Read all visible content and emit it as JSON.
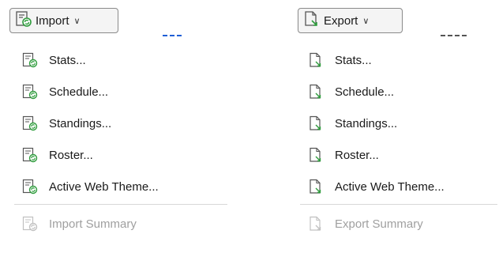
{
  "import_menu": {
    "button_label": "Import",
    "button_icon": "import-icon",
    "chevron_icon": "chevron-down-icon",
    "items": [
      {
        "label": "Stats...",
        "icon": "import-icon"
      },
      {
        "label": "Schedule...",
        "icon": "import-icon"
      },
      {
        "label": "Standings...",
        "icon": "import-icon"
      },
      {
        "label": "Roster...",
        "icon": "import-icon"
      },
      {
        "label": "Active Web Theme...",
        "icon": "import-icon"
      }
    ],
    "summary": {
      "label": "Import Summary",
      "icon": "import-icon",
      "disabled": true
    }
  },
  "export_menu": {
    "button_label": "Export",
    "button_icon": "export-icon",
    "chevron_icon": "chevron-down-icon",
    "items": [
      {
        "label": "Stats...",
        "icon": "export-icon"
      },
      {
        "label": "Schedule...",
        "icon": "export-icon"
      },
      {
        "label": "Standings...",
        "icon": "export-icon"
      },
      {
        "label": "Roster...",
        "icon": "export-icon"
      },
      {
        "label": "Active Web Theme...",
        "icon": "export-icon"
      }
    ],
    "summary": {
      "label": "Export Summary",
      "icon": "export-icon",
      "disabled": true
    }
  },
  "colors": {
    "import_green": "#2e9c3c",
    "export_green": "#2e9c3c",
    "disabled_text": "#a0a0a0",
    "separator": "#d8d8d8",
    "accent_blue": "#1f5fd6"
  }
}
